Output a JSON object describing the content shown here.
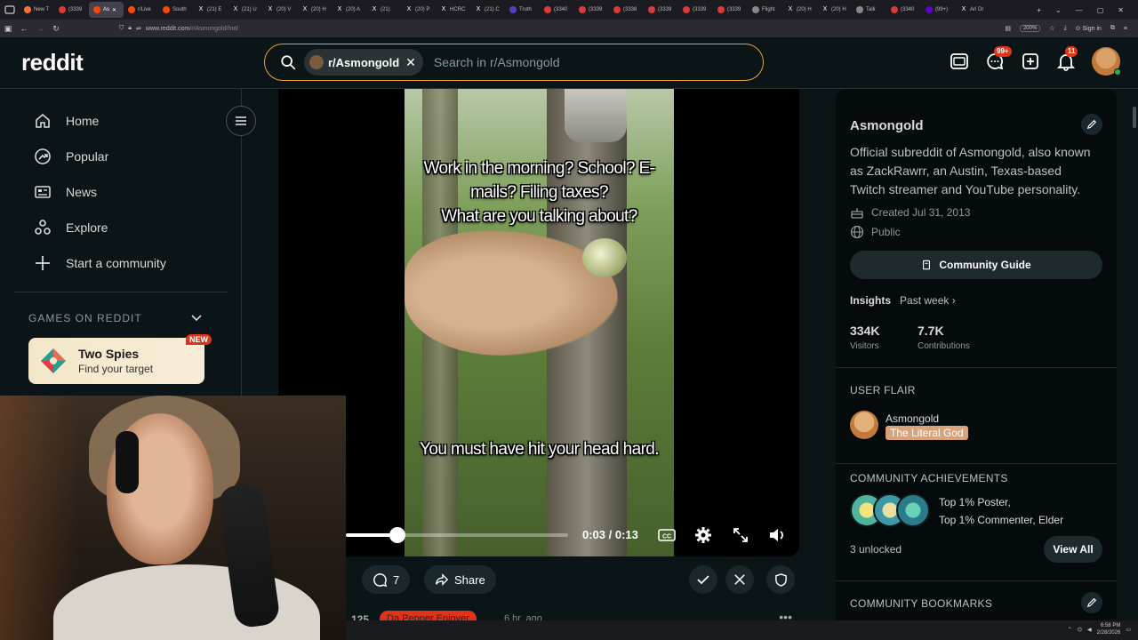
{
  "browser": {
    "tabs": [
      {
        "label": "New T",
        "icon": "firefox-icon"
      },
      {
        "label": "(3339",
        "icon": "youtube-icon"
      },
      {
        "label": "As",
        "icon": "reddit-icon",
        "active": true
      },
      {
        "label": "r/Live",
        "icon": "reddit-icon"
      },
      {
        "label": "South",
        "icon": "reddit-icon"
      },
      {
        "label": "(21) E",
        "icon": "x-icon"
      },
      {
        "label": "(21) U",
        "icon": "x-icon"
      },
      {
        "label": "(20) V",
        "icon": "x-icon"
      },
      {
        "label": "(20) H",
        "icon": "x-icon"
      },
      {
        "label": "(20) A",
        "icon": "x-icon"
      },
      {
        "label": "(21)",
        "icon": "x-icon"
      },
      {
        "label": "(20) P",
        "icon": "x-icon"
      },
      {
        "label": "HCRC",
        "icon": "x-icon"
      },
      {
        "label": "(21) C",
        "icon": "x-icon"
      },
      {
        "label": "Truth",
        "icon": "truth-icon"
      },
      {
        "label": "(3340",
        "icon": "youtube-icon"
      },
      {
        "label": "(3339",
        "icon": "youtube-icon"
      },
      {
        "label": "(3338",
        "icon": "youtube-icon"
      },
      {
        "label": "(3339",
        "icon": "youtube-icon"
      },
      {
        "label": "(3339",
        "icon": "youtube-icon"
      },
      {
        "label": "(3339",
        "icon": "youtube-icon"
      },
      {
        "label": "Flight",
        "icon": "globe-icon"
      },
      {
        "label": "(20) H",
        "icon": "x-icon"
      },
      {
        "label": "(20) H",
        "icon": "x-icon"
      },
      {
        "label": "Talk",
        "icon": "globe-icon"
      },
      {
        "label": "(3340",
        "icon": "youtube-icon"
      },
      {
        "label": "(99+)",
        "icon": "yahoo-icon"
      },
      {
        "label": "Ari Dr",
        "icon": "x-icon"
      }
    ],
    "url_host": "www.reddit.com",
    "url_path": "/r/Asmongold/hot/",
    "zoom": "200%",
    "sign_in": "Sign in"
  },
  "header": {
    "logo": "reddit",
    "search_chip": "r/Asmongold",
    "search_placeholder": "Search in r/Asmongold",
    "chat_badge": "99+",
    "notif_badge": "11"
  },
  "sidebar": {
    "items": [
      {
        "label": "Home",
        "icon": "home-icon"
      },
      {
        "label": "Popular",
        "icon": "popular-icon"
      },
      {
        "label": "News",
        "icon": "news-icon"
      },
      {
        "label": "Explore",
        "icon": "explore-icon"
      },
      {
        "label": "Start a community",
        "icon": "plus-icon"
      }
    ],
    "games_title": "GAMES ON REDDIT",
    "game": {
      "title": "Two Spies",
      "subtitle": "Find your target",
      "badge": "NEW"
    }
  },
  "video": {
    "caption_top": "Work in the morning? School? E-mails? Filing taxes?\nWhat are you talking about?",
    "caption_bottom": "You must have hit your head hard.",
    "time": "0:03 / 0:13",
    "progress": 0.23
  },
  "actions": {
    "comments": "7",
    "share": "Share"
  },
  "next_post": {
    "score": "125",
    "flair": "Da Pepper Enjoyer",
    "age": "6 hr. ago"
  },
  "community": {
    "name": "Asmongold",
    "description": "Official subreddit of Asmongold, also known as ZackRawrr, an Austin, Texas-based Twitch streamer and YouTube personality.",
    "created": "Created Jul 31, 2013",
    "visibility": "Public",
    "guide_label": "Community Guide",
    "insights_label": "Insights",
    "insights_period": "Past week",
    "visitors_value": "334K",
    "visitors_label": "Visitors",
    "contrib_value": "7.7K",
    "contrib_label": "Contributions",
    "user_flair_title": "USER FLAIR",
    "flair_user": "Asmongold",
    "flair_tag": "The Literal God",
    "achievements_title": "COMMUNITY ACHIEVEMENTS",
    "achievements_line1": "Top 1% Poster,",
    "achievements_line2": "Top 1% Commenter, Elder",
    "unlocked": "3 unlocked",
    "view_all": "View All",
    "bookmarks_title": "COMMUNITY BOOKMARKS"
  },
  "taskbar": {
    "time": "6:58 PM",
    "date": "2/28/2026"
  },
  "colors": {
    "accent_search": "#e8a33a",
    "badge_red": "#e0341a",
    "flair_tag": "#d9a37a"
  }
}
